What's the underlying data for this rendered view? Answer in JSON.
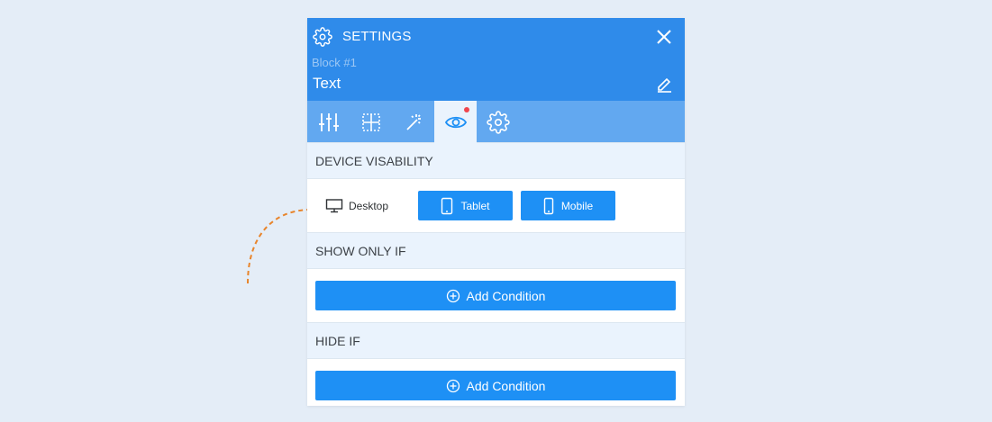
{
  "header": {
    "title": "SETTINGS",
    "block_label": "Block #1",
    "block_name": "Text"
  },
  "tabs": [
    {
      "icon": "sliders-icon",
      "active": false
    },
    {
      "icon": "grid-icon",
      "active": false
    },
    {
      "icon": "magic-wand-icon",
      "active": false
    },
    {
      "icon": "eye-icon",
      "active": true,
      "badge": true
    },
    {
      "icon": "gear-icon",
      "active": false
    }
  ],
  "device_visibility": {
    "heading": "DEVICE VISABILITY",
    "desktop_label": "Desktop",
    "tablet_label": "Tablet",
    "mobile_label": "Mobile"
  },
  "show_only_if": {
    "heading": "SHOW ONLY IF",
    "add_label": "Add Condition"
  },
  "hide_if": {
    "heading": "HIDE IF",
    "add_label": "Add Condition"
  },
  "colors": {
    "header": "#2f8bea",
    "tabs_bar": "#62a8f0",
    "button": "#1e90f5",
    "section_bg": "#eaf3fd",
    "badge": "#f0464e",
    "arrow": "#e8852c"
  }
}
